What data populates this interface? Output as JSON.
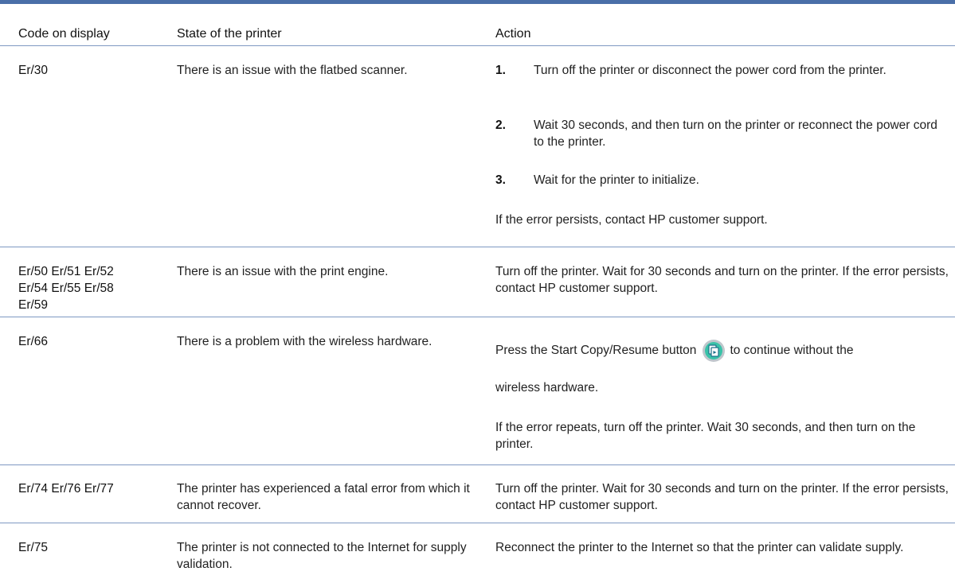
{
  "header": {
    "col_code": "Code on display",
    "col_state": "State of the printer",
    "col_action": "Action"
  },
  "rows": [
    {
      "code": "Er/30",
      "state": "There is an issue with the flatbed scanner.",
      "steps": [
        {
          "num": "1.",
          "text": "Turn off the printer or disconnect the power cord from the printer."
        },
        {
          "num": "2.",
          "text": "Wait 30 seconds, and then turn on the printer or reconnect the power cord to the printer."
        },
        {
          "num": "3.",
          "text": "Wait for the printer to initialize."
        }
      ],
      "note": "If the error persists, contact HP customer support."
    },
    {
      "code": "Er/50 Er/51 Er/52 Er/54 Er/55 Er/58 Er/59",
      "state": "There is an issue with the print engine.",
      "action": "Turn off the printer. Wait for 30 seconds and turn on the printer. If the error persists, contact HP customer support."
    },
    {
      "code": "Er/66",
      "state": "There is a problem with the wireless hardware.",
      "action_before_icon": "Press the Start Copy/Resume button",
      "action_after_icon": "to continue without the",
      "action_line2": "wireless hardware.",
      "icon": "start-copy-resume-icon",
      "note": "If the error repeats, turn off the printer. Wait 30 seconds, and then turn on the printer."
    },
    {
      "code": "Er/74 Er/76 Er/77",
      "state": "The printer has experienced a fatal error from which it cannot recover.",
      "action": "Turn off the printer. Wait for 30 seconds and turn on the printer. If the error persists, contact HP customer support."
    },
    {
      "code": "Er/75",
      "state": "The printer is not connected to the Internet for supply validation.",
      "action": "Reconnect the printer to the Internet so that the printer can validate supply."
    }
  ],
  "colors": {
    "rule": "#7e98c2",
    "top_bar": "#4a6fa8",
    "icon_accent": "#39c2a8"
  }
}
